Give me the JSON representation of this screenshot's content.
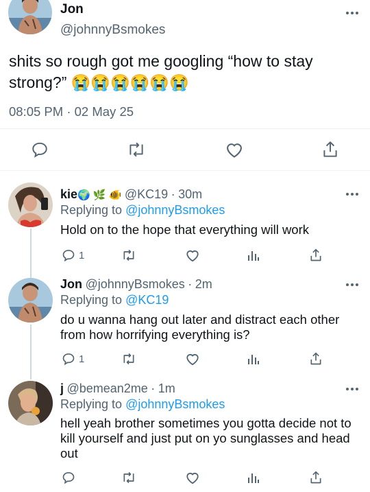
{
  "main_tweet": {
    "name": "Jon",
    "handle": "@johnnyBsmokes",
    "text": "shits so rough got me googling “how to stay strong?” 😭😭😭😭😭😭",
    "time": "08:05 PM",
    "separator": "·",
    "date": "02 May 25"
  },
  "replies": [
    {
      "name": "kie",
      "name_emoji": "🌍 🌿 🐠",
      "handle": "@KC19",
      "ago": "30m",
      "replying_prefix": "Replying to",
      "replying_to": "@johnnyBsmokes",
      "text_line1": "Hold on to the hope that everything will work",
      "text_line2": "",
      "text_line3": "",
      "reply_count": "1"
    },
    {
      "name": "Jon",
      "handle": "@johnnyBsmokes",
      "ago": "2m",
      "replying_prefix": "Replying to",
      "replying_to": "@KC19",
      "text_line1": "do u wanna hang out later and distract each other",
      "text_line2": "from how horrifying everything is?",
      "text_line3": "",
      "reply_count": "1"
    },
    {
      "name": "j",
      "handle": "@bemean2me",
      "ago": "1m",
      "replying_prefix": "Replying to",
      "replying_to": "@johnnyBsmokes",
      "text_line1": "hell yeah brother sometimes you gotta decide not to",
      "text_line2": "kill yourself and just put on yo sunglasses and head",
      "text_line3": "out",
      "reply_count": ""
    }
  ],
  "colors": {
    "accent": "#1d9bf0",
    "muted": "#536471",
    "text": "#0f1419"
  },
  "icons": [
    "more-icon",
    "reply-icon",
    "retweet-icon",
    "like-icon",
    "views-icon",
    "share-icon"
  ]
}
